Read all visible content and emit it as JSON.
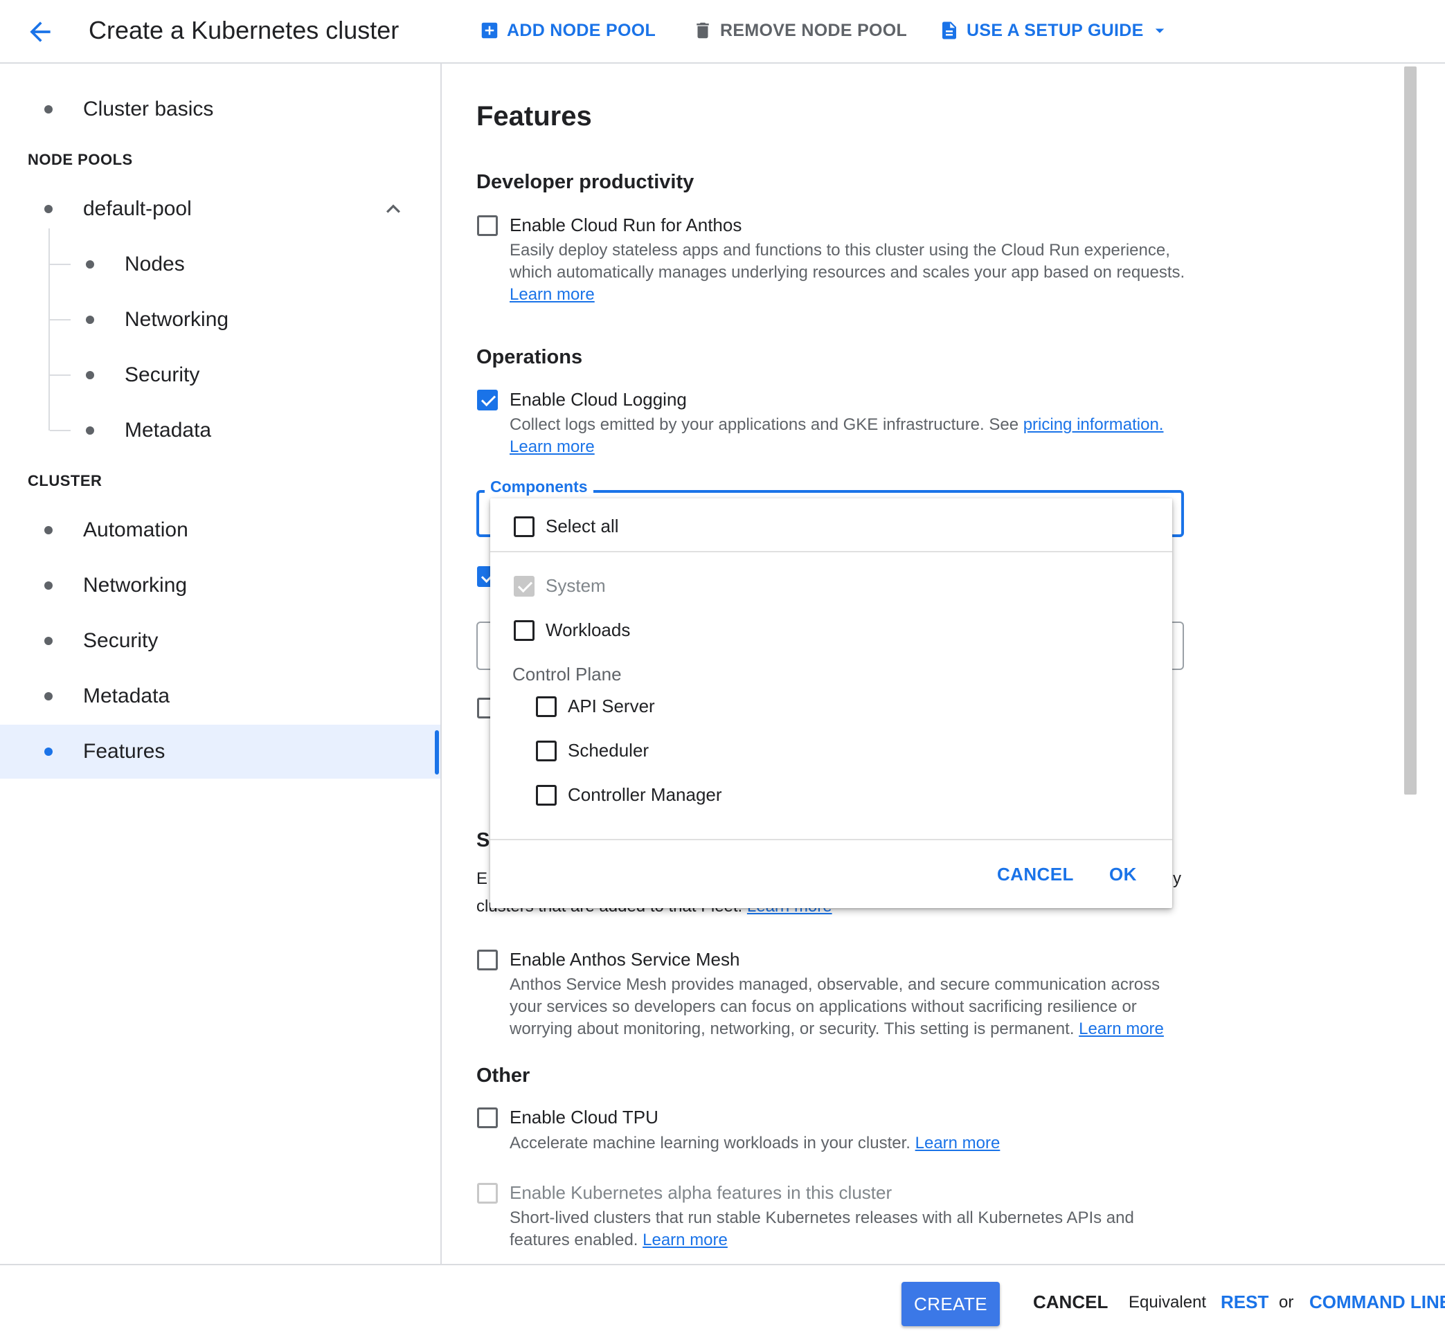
{
  "header": {
    "title": "Create a Kubernetes cluster",
    "add_node_pool": "ADD NODE POOL",
    "remove_node_pool": "REMOVE NODE POOL",
    "setup_guide": "USE A SETUP GUIDE"
  },
  "sidebar": {
    "cluster_basics": "Cluster basics",
    "node_pools_label": "NODE POOLS",
    "default_pool": "default-pool",
    "pool_items": [
      "Nodes",
      "Networking",
      "Security",
      "Metadata"
    ],
    "cluster_label": "CLUSTER",
    "cluster_items": [
      "Automation",
      "Networking",
      "Security",
      "Metadata",
      "Features"
    ],
    "active_item": "Features"
  },
  "main": {
    "title": "Features",
    "developer_productivity": {
      "heading": "Developer productivity",
      "cloud_run_label": "Enable Cloud Run for Anthos",
      "cloud_run_checked": false,
      "cloud_run_desc_1": "Easily deploy stateless apps and functions to this cluster using the Cloud Run experience,",
      "cloud_run_desc_2": "which automatically manages underlying resources and scales your app based on requests.",
      "learn_more": "Learn more"
    },
    "operations": {
      "heading": "Operations",
      "logging_label": "Enable Cloud Logging",
      "logging_checked": true,
      "logging_desc": "Collect logs emitted by your applications and GKE infrastructure. See ",
      "pricing_link": "pricing information.",
      "learn_more": "Learn more",
      "components_label": "Components"
    },
    "obscured": {
      "heading_fragment": "S",
      "line_fragment_left": "E",
      "line_fragment_right": "y",
      "line2": "clusters that are added to that Fleet. ",
      "learn_more": "Learn more"
    },
    "service_mesh": {
      "label": "Enable Anthos Service Mesh",
      "checked": false,
      "desc_1": "Anthos Service Mesh provides managed, observable, and secure communication across",
      "desc_2": "your services so developers can focus on applications without sacrificing resilience or",
      "desc_3": "worrying about monitoring, networking, or security. This setting is permanent. ",
      "learn_more": "Learn more"
    },
    "other": {
      "heading": "Other",
      "tpu_label": "Enable Cloud TPU",
      "tpu_checked": false,
      "tpu_desc": "Accelerate machine learning workloads in your cluster. ",
      "tpu_learn_more": "Learn more",
      "alpha_label": "Enable Kubernetes alpha features in this cluster",
      "alpha_desc_1": "Short-lived clusters that run stable Kubernetes releases with all Kubernetes APIs and",
      "alpha_desc_2": "features enabled. ",
      "alpha_learn_more": "Learn more"
    }
  },
  "dropdown": {
    "select_all": "Select all",
    "system": "System",
    "system_checked": true,
    "workloads": "Workloads",
    "control_plane": "Control Plane",
    "api_server": "API Server",
    "scheduler": "Scheduler",
    "controller_manager": "Controller Manager",
    "cancel": "CANCEL",
    "ok": "OK"
  },
  "footer": {
    "create": "CREATE",
    "cancel": "CANCEL",
    "equivalent": "Equivalent",
    "rest": "REST",
    "or": "or",
    "command_line": "COMMAND LINE"
  },
  "colors": {
    "accent": "#1a73e8",
    "text": "#202124",
    "secondary_text": "#5f6368",
    "active_bg": "#e8f0fe"
  },
  "icons": {
    "back": "arrow-back-icon",
    "add": "add-box-icon",
    "delete": "trash-icon",
    "guide": "document-icon",
    "dropdown": "caret-down-icon",
    "collapse": "chevron-up-icon"
  }
}
